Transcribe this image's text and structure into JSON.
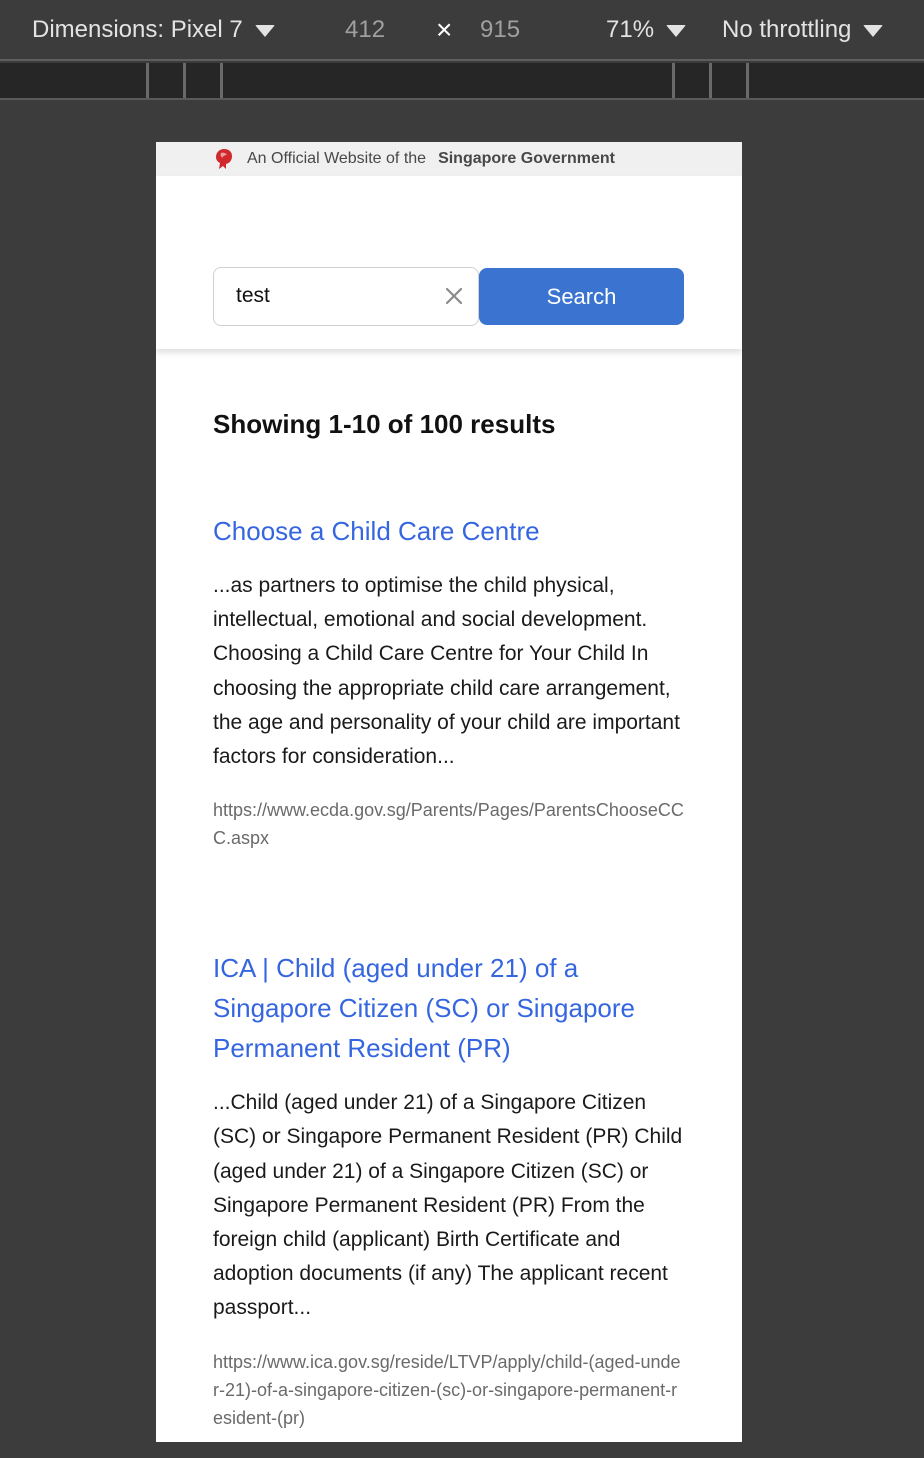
{
  "devtools": {
    "dimensions_label": "Dimensions: Pixel 7",
    "width": "412",
    "times": "×",
    "height": "915",
    "zoom": "71%",
    "throttling": "No throttling"
  },
  "masthead": {
    "text": "An Official Website of the",
    "government": "Singapore Government"
  },
  "search": {
    "value": "test",
    "button_label": "Search"
  },
  "results": {
    "summary": "Showing 1-10 of 100 results",
    "items": [
      {
        "title": "Choose a Child Care Centre",
        "snippet": "...as partners to optimise the child physical, intellectual, emotional and social development. Choosing a Child Care Centre for Your Child In choosing the appropriate child care arrangement, the age and personality of your child are important factors for consideration...",
        "url": "https://www.ecda.gov.sg/Parents/Pages/ParentsChooseCCC.aspx"
      },
      {
        "title": "ICA | Child (aged under 21) of a Singapore Citizen (SC) or Singapore Permanent Resident (PR)",
        "snippet": "...Child (aged under 21) of a Singapore Citizen (SC) or Singapore Permanent Resident (PR) Child (aged under 21) of a Singapore Citizen (SC) or Singapore Permanent Resident (PR) From the foreign child (applicant) Birth Certificate and adoption documents (if any) The applicant recent passport...",
        "url": "https://www.ica.gov.sg/reside/LTVP/apply/child-(aged-under-21)-of-a-singapore-citizen-(sc)-or-singapore-permanent-resident-(pr)"
      }
    ]
  },
  "colors": {
    "link": "#3566e0",
    "button": "#3a74d0",
    "lion": "#d0282c"
  },
  "icons": [
    "chevron-down-icon",
    "close-icon",
    "lion-head-icon",
    "clear-icon"
  ]
}
